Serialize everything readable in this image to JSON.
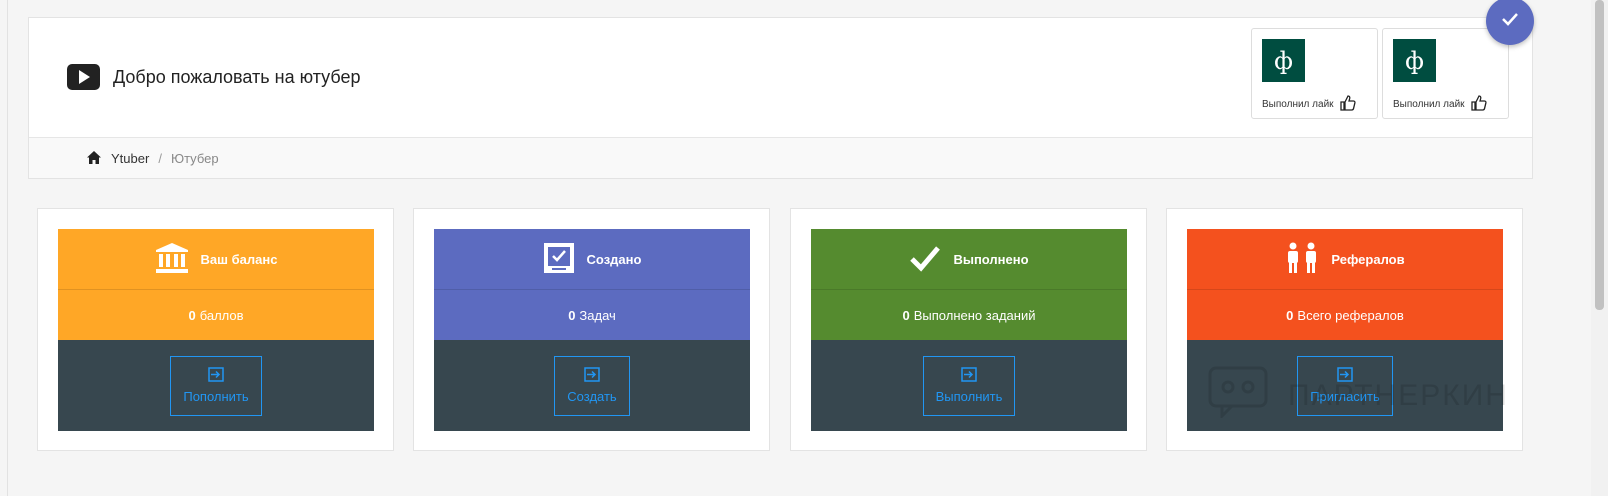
{
  "header": {
    "title": "Добро пожаловать на ютубер",
    "icon": "play-icon"
  },
  "breadcrumb": {
    "home": "Ytuber",
    "separator": "/",
    "current": "Ютубер"
  },
  "notifications": [
    {
      "avatar_letter": "ф",
      "text": "Выполнил лайк",
      "icon": "thumbs-up-icon"
    },
    {
      "avatar_letter": "ф",
      "text": "Выполнил лайк",
      "icon": "thumbs-up-icon"
    }
  ],
  "fab": {
    "icon": "check-icon"
  },
  "cards": [
    {
      "title": "Ваш баланс",
      "icon": "bank-icon",
      "value": "0",
      "value_label": "баллов",
      "button": "Пополнить",
      "color": "#ffa726"
    },
    {
      "title": "Создано",
      "icon": "checkbox-icon",
      "value": "0",
      "value_label": "Задач",
      "button": "Создать",
      "color": "#5c6bc0"
    },
    {
      "title": "Выполнено",
      "icon": "check-icon",
      "value": "0",
      "value_label": "Выполнено заданий",
      "button": "Выполнить",
      "color": "#558b2f"
    },
    {
      "title": "Рефералов",
      "icon": "people-icon",
      "value": "0",
      "value_label": "Всего рефералов",
      "button": "Пригласить",
      "color": "#f4511e"
    }
  ],
  "colors": {
    "card_footer": "#37474f",
    "button_accent": "#2196f3",
    "avatar": "#004d40"
  },
  "watermark": "ПАРТНЕРКИН"
}
